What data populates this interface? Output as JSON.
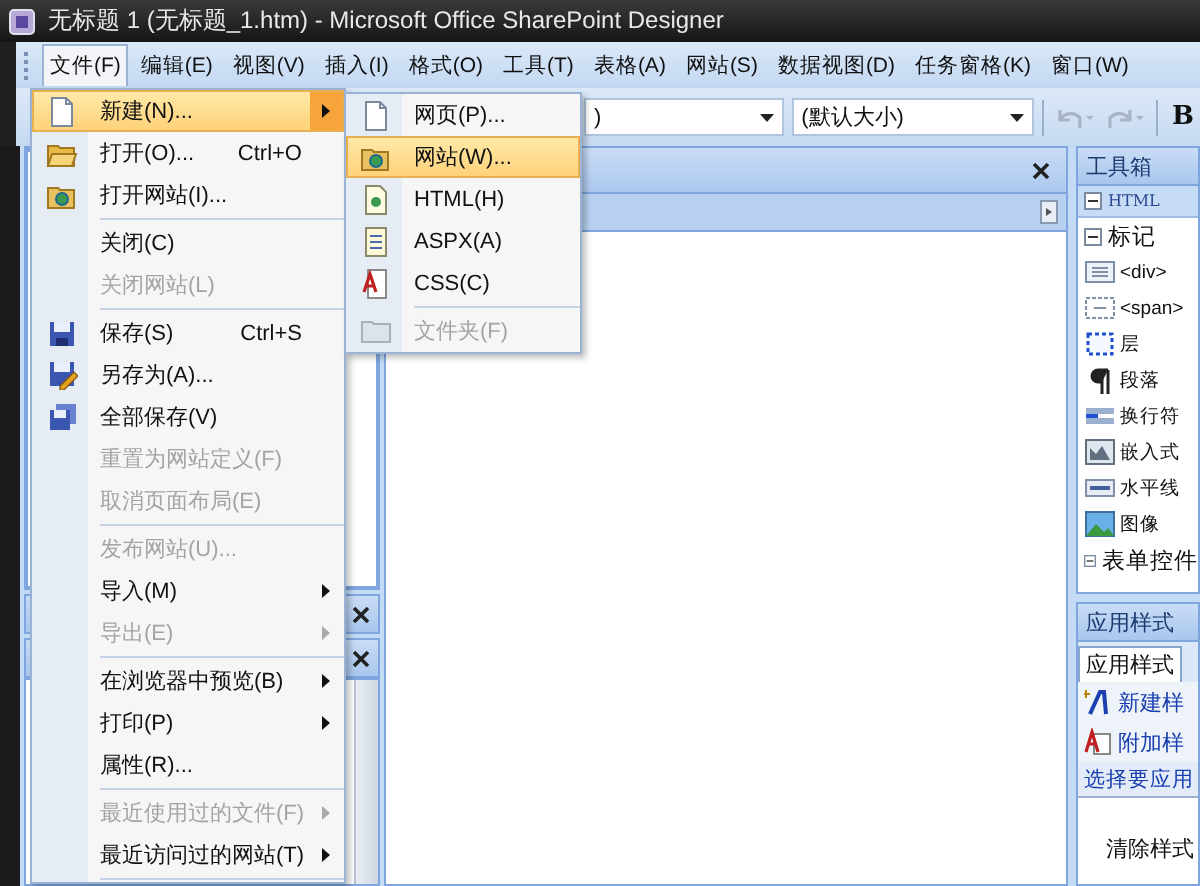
{
  "window": {
    "title": "无标题 1 (无标题_1.htm) - Microsoft Office SharePoint Designer"
  },
  "menubar": [
    {
      "label": "文件(F)",
      "selected": true
    },
    {
      "label": "编辑(E)",
      "selected": false
    },
    {
      "label": "视图(V)",
      "selected": false
    },
    {
      "label": "插入(I)",
      "selected": false
    },
    {
      "label": "格式(O)",
      "selected": false
    },
    {
      "label": "工具(T)",
      "selected": false
    },
    {
      "label": "表格(A)",
      "selected": false
    },
    {
      "label": "网站(S)",
      "selected": false
    },
    {
      "label": "数据视图(D)",
      "selected": false
    },
    {
      "label": "任务窗格(K)",
      "selected": false
    },
    {
      "label": "窗口(W)",
      "selected": false
    }
  ],
  "toolbar": {
    "font_dropdown": {
      "value": ")"
    },
    "size_dropdown": {
      "value": "(默认大小)"
    },
    "bold_button": "B"
  },
  "file_menu": {
    "items": [
      {
        "kind": "item",
        "label": "新建(N)...",
        "selected": true,
        "disabled": false,
        "submenu": true
      },
      {
        "kind": "item",
        "label": "打开(O)...",
        "shortcut": "Ctrl+O",
        "selected": false,
        "disabled": false,
        "submenu": false
      },
      {
        "kind": "item",
        "label": "打开网站(I)...",
        "selected": false,
        "disabled": false,
        "submenu": false
      },
      {
        "kind": "separator"
      },
      {
        "kind": "item",
        "label": "关闭(C)",
        "selected": false,
        "disabled": false,
        "submenu": false
      },
      {
        "kind": "item",
        "label": "关闭网站(L)",
        "selected": false,
        "disabled": true,
        "submenu": false
      },
      {
        "kind": "separator"
      },
      {
        "kind": "item",
        "label": "保存(S)",
        "shortcut": "Ctrl+S",
        "selected": false,
        "disabled": false,
        "submenu": false
      },
      {
        "kind": "item",
        "label": "另存为(A)...",
        "selected": false,
        "disabled": false,
        "submenu": false
      },
      {
        "kind": "item",
        "label": "全部保存(V)",
        "selected": false,
        "disabled": false,
        "submenu": false
      },
      {
        "kind": "item",
        "label": "重置为网站定义(F)",
        "selected": false,
        "disabled": true,
        "submenu": false
      },
      {
        "kind": "item",
        "label": "取消页面布局(E)",
        "selected": false,
        "disabled": true,
        "submenu": false
      },
      {
        "kind": "separator"
      },
      {
        "kind": "item",
        "label": "发布网站(U)...",
        "selected": false,
        "disabled": true,
        "submenu": false
      },
      {
        "kind": "item",
        "label": "导入(M)",
        "selected": false,
        "disabled": false,
        "submenu": true
      },
      {
        "kind": "item",
        "label": "导出(E)",
        "selected": false,
        "disabled": true,
        "submenu": true
      },
      {
        "kind": "separator"
      },
      {
        "kind": "item",
        "label": "在浏览器中预览(B)",
        "selected": false,
        "disabled": false,
        "submenu": true
      },
      {
        "kind": "item",
        "label": "打印(P)",
        "selected": false,
        "disabled": false,
        "submenu": true
      },
      {
        "kind": "item",
        "label": "属性(R)...",
        "selected": false,
        "disabled": false,
        "submenu": false
      },
      {
        "kind": "separator"
      },
      {
        "kind": "item",
        "label": "最近使用过的文件(F)",
        "selected": false,
        "disabled": true,
        "submenu": true
      },
      {
        "kind": "item",
        "label": "最近访问过的网站(T)",
        "selected": false,
        "disabled": false,
        "submenu": true
      },
      {
        "kind": "separator"
      }
    ]
  },
  "new_submenu": {
    "items": [
      {
        "kind": "item",
        "label": "网页(P)...",
        "selected": false,
        "disabled": false
      },
      {
        "kind": "item",
        "label": "网站(W)...",
        "selected": true,
        "disabled": false
      },
      {
        "kind": "item",
        "label": "HTML(H)",
        "selected": false,
        "disabled": false
      },
      {
        "kind": "item",
        "label": "ASPX(A)",
        "selected": false,
        "disabled": false
      },
      {
        "kind": "item",
        "label": "CSS(C)",
        "selected": false,
        "disabled": false
      },
      {
        "kind": "separator"
      },
      {
        "kind": "item",
        "label": "文件夹(F)",
        "selected": false,
        "disabled": true
      }
    ]
  },
  "toolbox": {
    "title": "工具箱",
    "sections": [
      {
        "kind": "category",
        "label": "HTML",
        "expanded": true
      },
      {
        "kind": "group",
        "label": "标记",
        "expanded": true,
        "children": [
          {
            "label": "<div>"
          },
          {
            "label": "<span>"
          },
          {
            "label": "层"
          },
          {
            "label": "段落"
          },
          {
            "label": "换行符"
          },
          {
            "label": "嵌入式"
          },
          {
            "label": "水平线"
          },
          {
            "label": "图像"
          }
        ]
      },
      {
        "kind": "group",
        "label": "表单控件",
        "expanded": true
      }
    ]
  },
  "apply_styles": {
    "title": "应用样式",
    "tabs": [
      {
        "label": "应用样式",
        "selected": true
      }
    ],
    "actions": [
      "新建样",
      "附加样"
    ],
    "hint": "选择要应用",
    "styles": [
      "清除样式"
    ]
  }
}
